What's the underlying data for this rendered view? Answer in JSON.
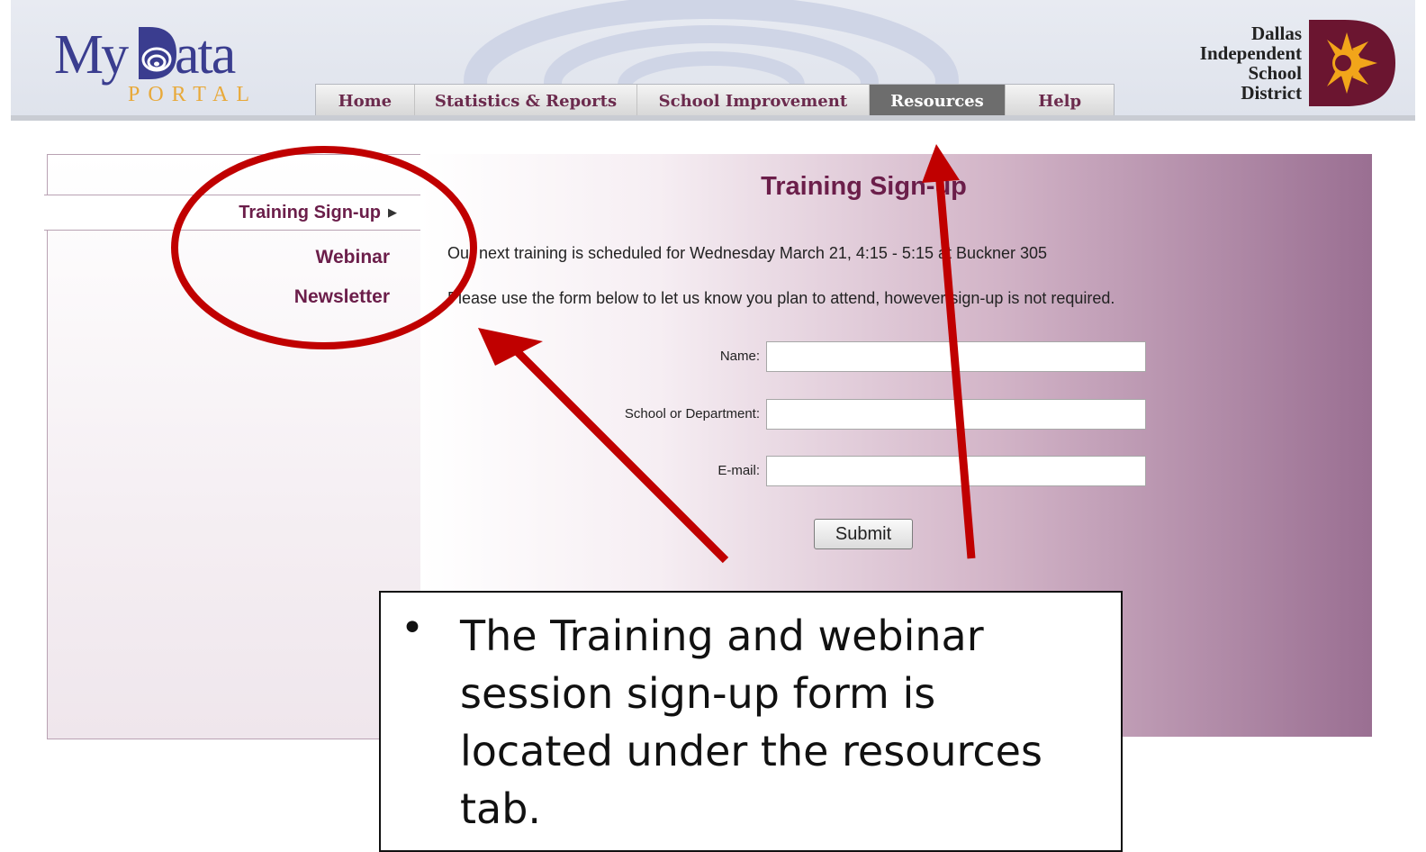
{
  "header": {
    "logo": {
      "my": "My",
      "ata": "ata",
      "portal": "PORTAL"
    },
    "nav_tabs": [
      {
        "label": "Home",
        "active": false
      },
      {
        "label": "Statistics & Reports",
        "active": false
      },
      {
        "label": "School Improvement",
        "active": false
      },
      {
        "label": "Resources",
        "active": true
      },
      {
        "label": "Help",
        "active": false
      }
    ],
    "district": {
      "line1": "Dallas",
      "line2": "Independent",
      "line3": "School",
      "line4": "District"
    }
  },
  "sidebar": {
    "items": [
      {
        "label": "Training Sign-up",
        "active": true
      },
      {
        "label": "Webinar",
        "active": false
      },
      {
        "label": "Newsletter",
        "active": false
      }
    ]
  },
  "main": {
    "title": "Training Sign-up",
    "schedule_text": "Our next training is scheduled for Wednesday March 21, 4:15 - 5:15 at Buckner 305",
    "instructions_text": "Please use the form below to let us know you plan to attend, however sign-up is not required.",
    "form": {
      "name_label": "Name:",
      "name_value": "",
      "department_label": "School or Department:",
      "department_value": "",
      "email_label": "E-mail:",
      "email_value": "",
      "submit_label": "Submit"
    }
  },
  "annotation": {
    "bullet": "•",
    "text": "The Training and webinar session sign-up form is located under the resources tab."
  },
  "colors": {
    "accent": "#6b1e4a",
    "active_tab": "#6d6d6d",
    "annotation_red": "#c00000",
    "logo_blue": "#3a3d8f",
    "logo_orange": "#e8a93a",
    "district_maroon": "#6b1530",
    "district_sun": "#f2a51a"
  }
}
